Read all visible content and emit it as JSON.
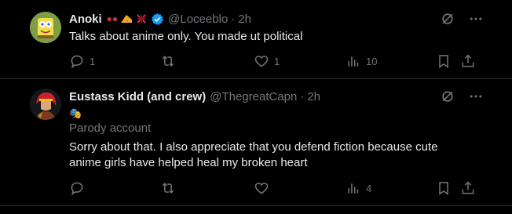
{
  "tweets": [
    {
      "name": "Anoki",
      "handle": "@Loceeblo",
      "separator": "·",
      "time": "2h",
      "text": "Talks about anime only. You made ut political",
      "reply_count": "1",
      "retweet_count": "",
      "like_count": "1",
      "view_count": "10"
    },
    {
      "name": "Eustass Kidd (and crew)",
      "handle": "@ThegreatCapn",
      "separator": "·",
      "time": "2h",
      "bio_emoji": "🎭",
      "parody_label": "Parody account",
      "text_line1": "Sorry about that. I also appreciate that you defend fiction because cute",
      "text_line2": "anime girls have helped heal my broken heart",
      "reply_count": "",
      "retweet_count": "",
      "like_count": "",
      "view_count": "4"
    }
  ],
  "colors": {
    "background": "#000000",
    "text": "#e7e9ea",
    "muted": "#71767b",
    "verified": "#1d9bf0",
    "divider": "#2f3336"
  }
}
